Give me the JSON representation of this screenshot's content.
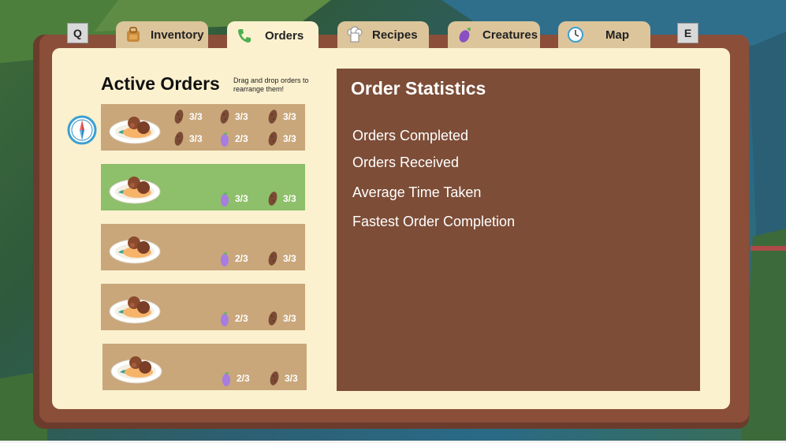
{
  "keys": {
    "left": "Q",
    "right": "E"
  },
  "tabs": [
    {
      "label": "Inventory",
      "icon": "backpack-icon"
    },
    {
      "label": "Orders",
      "icon": "phone-icon"
    },
    {
      "label": "Recipes",
      "icon": "chef-hat-icon"
    },
    {
      "label": "Creatures",
      "icon": "eggplant-icon"
    },
    {
      "label": "Map",
      "icon": "clock-icon"
    }
  ],
  "orders": {
    "title": "Active Orders",
    "hint": "Drag and drop orders to rearrange them!",
    "items": [
      {
        "selected": false,
        "ingredients": [
          {
            "icon": "potato-icon",
            "count": "3/3"
          },
          {
            "icon": "potato-icon",
            "count": "3/3"
          },
          {
            "icon": "potato-icon",
            "count": "3/3"
          },
          {
            "icon": "potato-icon",
            "count": "3/3"
          },
          {
            "icon": "eggplant-icon",
            "count": "2/3"
          },
          {
            "icon": "potato-icon",
            "count": "3/3"
          }
        ]
      },
      {
        "selected": true,
        "ingredients": [
          {
            "icon": "eggplant-icon",
            "count": "3/3"
          },
          {
            "icon": "potato-icon",
            "count": "3/3"
          }
        ]
      },
      {
        "selected": false,
        "ingredients": [
          {
            "icon": "eggplant-icon",
            "count": "2/3"
          },
          {
            "icon": "potato-icon",
            "count": "3/3"
          }
        ]
      },
      {
        "selected": false,
        "ingredients": [
          {
            "icon": "eggplant-icon",
            "count": "2/3"
          },
          {
            "icon": "potato-icon",
            "count": "3/3"
          }
        ]
      },
      {
        "selected": false,
        "ingredients": [
          {
            "icon": "eggplant-icon",
            "count": "2/3"
          },
          {
            "icon": "potato-icon",
            "count": "3/3"
          }
        ]
      }
    ]
  },
  "stats": {
    "title": "Order Statistics",
    "lines": [
      "Orders Completed",
      "Orders Received",
      "Average Time Taken",
      "Fastest Order Completion"
    ]
  },
  "colors": {
    "panel": "#fbf1cf",
    "frame": "#8a4e39",
    "card": "#c9a77b",
    "card_selected": "#8ebf6a",
    "stats_bg": "#7d4d37"
  }
}
